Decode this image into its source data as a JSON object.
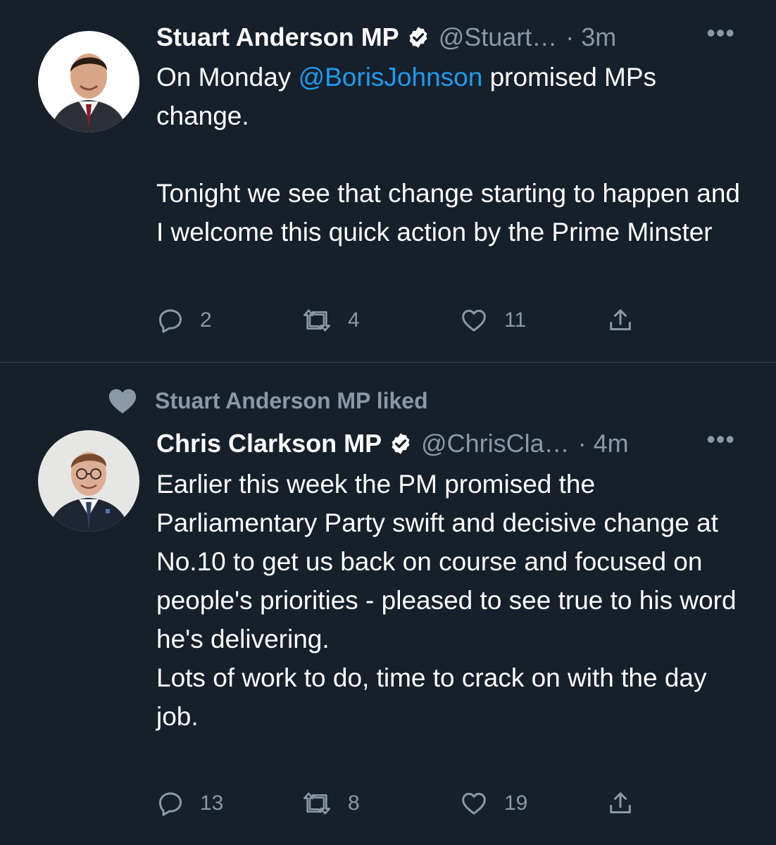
{
  "colors": {
    "background": "#15202b",
    "text": "#ffffff",
    "muted": "#8b98a5",
    "link": "#1d9bf0",
    "divider": "#38444d"
  },
  "tweets": [
    {
      "author_name": "Stuart Anderson MP",
      "handle": "@Stuart…",
      "time": "· 3m",
      "verified_icon": "verified-badge-icon",
      "more": "•••",
      "text_before_mention": "On Monday ",
      "mention": "@BorisJohnson",
      "text_after_mention": " promised MPs change.",
      "paragraph2": "Tonight we see that change starting to happen and I welcome this quick action by the Prime Minster",
      "replies": "2",
      "retweets": "4",
      "likes": "11"
    },
    {
      "context_label": "Stuart Anderson MP liked",
      "author_name": "Chris Clarkson MP",
      "handle": "@ChrisCla…",
      "time": "· 4m",
      "verified_icon": "verified-badge-icon",
      "more": "•••",
      "paragraph1": "Earlier this week the PM promised the Parliamentary Party swift and decisive change at No.10 to get us back on course and focused on people's priorities - pleased to see true to his word he's delivering.",
      "paragraph2": "Lots of work to do, time to crack on with the day job.",
      "replies": "13",
      "retweets": "8",
      "likes": "19"
    }
  ]
}
